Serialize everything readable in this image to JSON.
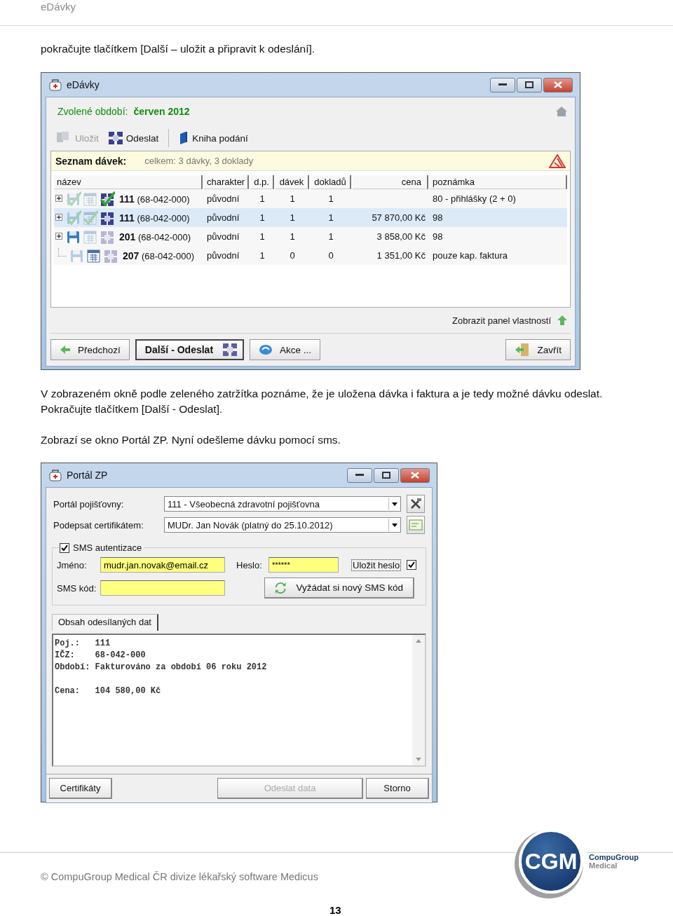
{
  "header": {
    "title": "eDávky"
  },
  "intro": "pokračujte tlačítkem [Další – uložit a připravit k odeslání].",
  "window_edavky": {
    "title": "eDávky",
    "period_label": "Zvolené období:",
    "period_value": "červen 2012",
    "toolbar": [
      {
        "kind": "save",
        "label": "Uložit",
        "disabled": true
      },
      {
        "kind": "send",
        "label": "Odeslat",
        "disabled": false
      },
      {
        "kind": "book",
        "label": "Kniha podání",
        "disabled": false
      }
    ],
    "list_title": "Seznam dávek:",
    "list_summary": "celkem: 3 dávky, 3 doklady",
    "columns": [
      "název",
      "charakter",
      "d.p.",
      "dávek",
      "dokladů",
      "cena",
      "poznámka"
    ],
    "rows": [
      {
        "expandable": true,
        "selected": false,
        "icons": [
          {
            "kind": "disk",
            "dimmed": true,
            "checked": true
          },
          {
            "kind": "doc",
            "dimmed": true,
            "checked": false
          },
          {
            "kind": "send",
            "dimmed": false,
            "checked": true
          }
        ],
        "code": "111",
        "icz": "(68-042-000)",
        "charakter": "původní",
        "dp": "1",
        "davek": "1",
        "dokladu": "1",
        "poznamka": "80 - přihlášky (2 + 0)"
      },
      {
        "expandable": true,
        "selected": true,
        "icons": [
          {
            "kind": "disk",
            "dimmed": true,
            "checked": true
          },
          {
            "kind": "doc",
            "dimmed": true,
            "checked": true
          },
          {
            "kind": "send",
            "dimmed": false,
            "checked": false
          }
        ],
        "code": "111",
        "icz": "(68-042-000)",
        "charakter": "původní",
        "dp": "1",
        "davek": "1",
        "dokladu": "1",
        "cena": "57 870,00 Kč",
        "poznamka": "98"
      },
      {
        "expandable": true,
        "selected": false,
        "icons": [
          {
            "kind": "disk",
            "dimmed": false,
            "checked": false
          },
          {
            "kind": "doc",
            "dimmed": true,
            "checked": false
          },
          {
            "kind": "send",
            "dimmed": true,
            "checked": false
          }
        ],
        "code": "201",
        "icz": "(68-042-000)",
        "charakter": "původní",
        "dp": "1",
        "davek": "1",
        "dokladu": "1",
        "cena": "3 858,00 Kč",
        "poznamka": "98"
      },
      {
        "expandable": false,
        "selected": false,
        "icons": [
          {
            "kind": "disk",
            "dimmed": true,
            "checked": false
          },
          {
            "kind": "doc",
            "dimmed": false,
            "checked": false
          },
          {
            "kind": "send",
            "dimmed": true,
            "checked": false
          }
        ],
        "code": "207",
        "icz": "(68-042-000)",
        "charakter": "původní",
        "dp": "1",
        "davek": "0",
        "dokladu": "0",
        "cena": "1 351,00 Kč",
        "poznamka": "pouze kap. faktura"
      }
    ],
    "panel_link": "Zobrazit panel vlastností",
    "buttons": [
      {
        "kind": "back",
        "label": "Předchozí"
      },
      {
        "kind": "default",
        "label": "Další - Odeslat"
      },
      {
        "kind": "action",
        "label": "Akce ..."
      },
      {
        "kind": "close",
        "label": "Zavřít"
      }
    ]
  },
  "paragraph_1": "V zobrazeném okně podle zeleného zatržítka poznáme, že je uložena dávka i faktura a je tedy možné dávku odeslat. Pokračujte tlačítkem [Další - Odeslat].",
  "paragraph_2": "Zobrazí se okno Portál ZP. Nyní odešleme dávku pomocí sms.",
  "window_portal": {
    "title": "Portál ZP",
    "fields": [
      {
        "kind": "tools",
        "label": "Portál pojišťovny:",
        "value": "111 - Všeobecná zdravotní pojišťovna"
      },
      {
        "kind": "certificate",
        "label": "Podepsat certifikátem:",
        "value": "MUDr. Jan Novák (platný do 25.10.2012)"
      }
    ],
    "sms": {
      "label": "SMS autentizace",
      "checked": true,
      "name_label": "Jméno:",
      "name_value": "mudr.jan.novak@email.cz",
      "password_label": "Heslo:",
      "password_value": "******",
      "save_label": "Uložit heslo",
      "save_checked": true,
      "code_label": "SMS kód:",
      "request_button": "Vyžádat si nový SMS kód"
    },
    "tab": "Obsah odesílaných dat",
    "content_blocks": [
      [
        "Poj.:   111",
        "IČZ:    68-042-000",
        "Období: Fakturováno za období 06 roku 2012"
      ],
      [
        "Cena:   104 580,00 Kč"
      ]
    ],
    "buttons": [
      {
        "label": "Certifikáty",
        "disabled": false
      },
      {
        "label": "Odeslat data",
        "disabled": true
      },
      {
        "label": "Storno",
        "disabled": false
      }
    ]
  },
  "footer": {
    "copyright": "© CompuGroup Medical ČR divize lékařský software Medicus",
    "logo_mark": "CGM",
    "logo_name": [
      "CompuGroup",
      "Medical"
    ],
    "page_number": "13"
  }
}
